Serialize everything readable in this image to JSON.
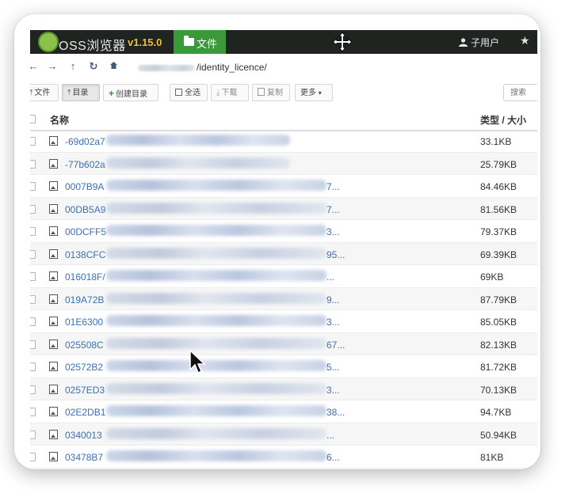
{
  "app": {
    "name": "OSS浏览器",
    "version": "v1.15.0",
    "nav_file_label": "文件",
    "user_label": "子用户",
    "star_glyph": "★"
  },
  "address": {
    "path": "/identity_licence/"
  },
  "toolbar": {
    "upload_file_label": "文件",
    "upload_dir_label": "目录",
    "create_dir_label": "创建目录",
    "select_all_label": "全选",
    "download_label": "下载",
    "copy_label": "复制",
    "more_label": "更多",
    "search_placeholder": "搜索"
  },
  "table": {
    "col_name": "名称",
    "col_type_size": "类型 / 大小",
    "rows": [
      {
        "name": "-69d02a7",
        "tail": "",
        "size": "33.1KB"
      },
      {
        "name": "-77b602a",
        "tail": "",
        "size": "25.79KB"
      },
      {
        "name": "0007B9A",
        "tail": "7...",
        "size": "84.46KB"
      },
      {
        "name": "00DB5A9",
        "tail": "7...",
        "size": "81.56KB"
      },
      {
        "name": "00DCFF5",
        "tail": "3...",
        "size": "79.37KB"
      },
      {
        "name": "0138CFC",
        "tail": "95...",
        "size": "69.39KB"
      },
      {
        "name": "016018F/",
        "tail": "...",
        "size": "69KB"
      },
      {
        "name": "019A72B",
        "tail": "9...",
        "size": "87.79KB"
      },
      {
        "name": "01E6300",
        "tail": "3...",
        "size": "85.05KB"
      },
      {
        "name": "025508C",
        "tail": "67...",
        "size": "82.13KB"
      },
      {
        "name": "02572B2",
        "tail": "5...",
        "size": "81.72KB"
      },
      {
        "name": "0257ED3",
        "tail": "3...",
        "size": "70.13KB"
      },
      {
        "name": "02E2DB1",
        "tail": "38...",
        "size": "94.7KB"
      },
      {
        "name": "0340013",
        "tail": "...",
        "size": "50.94KB"
      },
      {
        "name": "03478B7",
        "tail": "6...",
        "size": "81KB"
      }
    ]
  }
}
